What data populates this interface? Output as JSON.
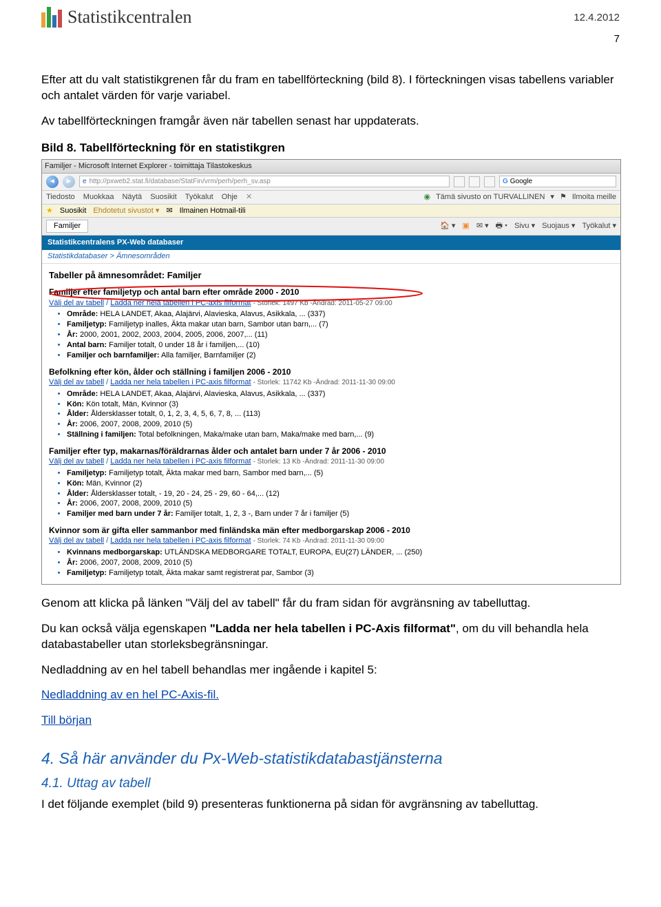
{
  "header": {
    "brand": "Statistikcentralen",
    "date": "12.4.2012",
    "page_number": "7"
  },
  "intro": {
    "p1a": "Efter att du valt statistikgrenen får du fram en tabellförteckning (bild 8). I förteckningen visas tabellens variabler och antalet värden för varje variabel.",
    "p1b": "Av tabellförteckningen framgår även när tabellen senast har uppdaterats.",
    "caption": "Bild 8. Tabellförteckning för en statistikgren"
  },
  "shot": {
    "ie_title": "Familjer - Microsoft Internet Explorer - toimittaja Tilastokeskus",
    "url": "http://pxweb2.stat.fi/database/StatFin/vrm/perh/perh_sv.asp",
    "search_ph": "Google",
    "menu": [
      "Tiedosto",
      "Muokkaa",
      "Näytä",
      "Suosikit",
      "Työkalut",
      "Ohje"
    ],
    "safety": "Tämä sivusto on TURVALLINEN",
    "report": "Ilmoita meille",
    "fav_label": "Suosikit",
    "fav_item1": "Ehdotetut sivustot",
    "fav_item2": "Ilmainen Hotmail-tili",
    "tab": "Familjer",
    "tab_tools": [
      "Sivu",
      "Suojaus",
      "Työkalut"
    ],
    "pxbar": "Statistikcentralens PX-Web databaser",
    "crumbs": "Statistikdatabaser > Ämnesområden",
    "h": "Tabeller på ämnesområdet: Familjer",
    "groups": [
      {
        "title": "Familjer efter familjetyp och antal barn efter område 2000 - 2010",
        "link_line": {
          "a": "Välj del av tabell",
          "b": "Ladda ner hela tabellen i PC-axis filformat",
          "meta": "- Storlek: 1497 Kb -Ändrad: 2011-05-27 09:00"
        },
        "bullets": [
          {
            "k": "Område:",
            "v": "HELA LANDET, Akaa, Alajärvi, Alavieska, Alavus, Asikkala, ... (337)"
          },
          {
            "k": "Familjetyp:",
            "v": "Familjetyp inalles, Äkta makar utan barn, Sambor utan barn,... (7)"
          },
          {
            "k": "År:",
            "v": "2000, 2001, 2002, 2003, 2004, 2005, 2006, 2007,... (11)"
          },
          {
            "k": "Antal barn:",
            "v": "Familjer totalt, 0 under 18 år i familjen,... (10)"
          },
          {
            "k": "Familjer och barnfamiljer:",
            "v": "Alla familjer, Barnfamiljer (2)"
          }
        ]
      },
      {
        "title": "Befolkning efter kön, ålder och ställning i familjen 2006 - 2010",
        "link_line": {
          "a": "Välj del av tabell",
          "b": "Ladda ner hela tabellen i PC-axis filformat",
          "meta": "- Storlek: 11742 Kb -Ändrad: 2011-11-30 09:00"
        },
        "bullets": [
          {
            "k": "Område:",
            "v": "HELA LANDET, Akaa, Alajärvi, Alavieska, Alavus, Asikkala, ... (337)"
          },
          {
            "k": "Kön:",
            "v": "Kön totalt, Män, Kvinnor (3)"
          },
          {
            "k": "Ålder:",
            "v": "Åldersklasser totalt, 0, 1, 2, 3, 4, 5, 6, 7, 8, ... (113)"
          },
          {
            "k": "År:",
            "v": "2006, 2007, 2008, 2009, 2010 (5)"
          },
          {
            "k": "Ställning i familjen:",
            "v": "Total befolkningen, Maka/make utan barn, Maka/make med barn,... (9)"
          }
        ]
      },
      {
        "title": "Familjer efter typ, makarnas/föräldrarnas ålder och antalet barn under 7 år 2006 - 2010",
        "link_line": {
          "a": "Välj del av tabell",
          "b": "Ladda ner hela tabellen i PC-axis filformat",
          "meta": "- Storlek: 13 Kb -Ändrad: 2011-11-30 09:00"
        },
        "bullets": [
          {
            "k": "Familjetyp:",
            "v": "Familjetyp totalt, Äkta makar med barn, Sambor med barn,... (5)"
          },
          {
            "k": "Kön:",
            "v": "Män, Kvinnor (2)"
          },
          {
            "k": "Ålder:",
            "v": "Åldersklasser totalt, - 19, 20 - 24, 25 - 29, 60 - 64,... (12)"
          },
          {
            "k": "År:",
            "v": "2006, 2007, 2008, 2009, 2010 (5)"
          },
          {
            "k": "Familjer med barn under 7 år:",
            "v": "Familjer totalt, 1, 2, 3 -, Barn under 7 år i familjer (5)"
          }
        ]
      },
      {
        "title": "Kvinnor som är gifta eller sammanbor med finländska män efter medborgarskap 2006 - 2010",
        "link_line": {
          "a": "Välj del av tabell",
          "b": "Ladda ner hela tabellen i PC-axis filformat",
          "meta": "- Storlek: 74 Kb -Ändrad: 2011-11-30 09:00"
        },
        "bullets": [
          {
            "k": "Kvinnans medborgarskap:",
            "v": "UTLÄNDSKA MEDBORGARE TOTALT, EUROPA, EU(27) LÄNDER, ... (250)"
          },
          {
            "k": "År:",
            "v": "2006, 2007, 2008, 2009, 2010 (5)"
          },
          {
            "k": "Familjetyp:",
            "v": "Familjetyp totalt, Äkta makar samt registrerat par, Sambor (3)"
          }
        ]
      }
    ]
  },
  "after": {
    "p1": "Genom att klicka på länken \"Välj del av tabell\" får du fram sidan för avgränsning av tabelluttag.",
    "p2a": "Du kan också välja egenskapen ",
    "p2b": "\"Ladda ner hela tabellen i PC-Axis filformat\"",
    "p2c": ", om du vill behandla hela databastabeller utan storleksbegränsningar.",
    "p3": "Nedladdning av en hel tabell behandlas mer ingående i kapitel 5:",
    "link1": " Nedladdning av en hel PC-Axis-fil.",
    "link2": "Till början"
  },
  "sect": {
    "h4": "4. Så här använder du Px-Web-statistikdatabastjänsterna",
    "h41": "4.1. Uttag av tabell",
    "p": "I det följande exemplet (bild 9) presenteras funktionerna på sidan för avgränsning av tabelluttag."
  }
}
